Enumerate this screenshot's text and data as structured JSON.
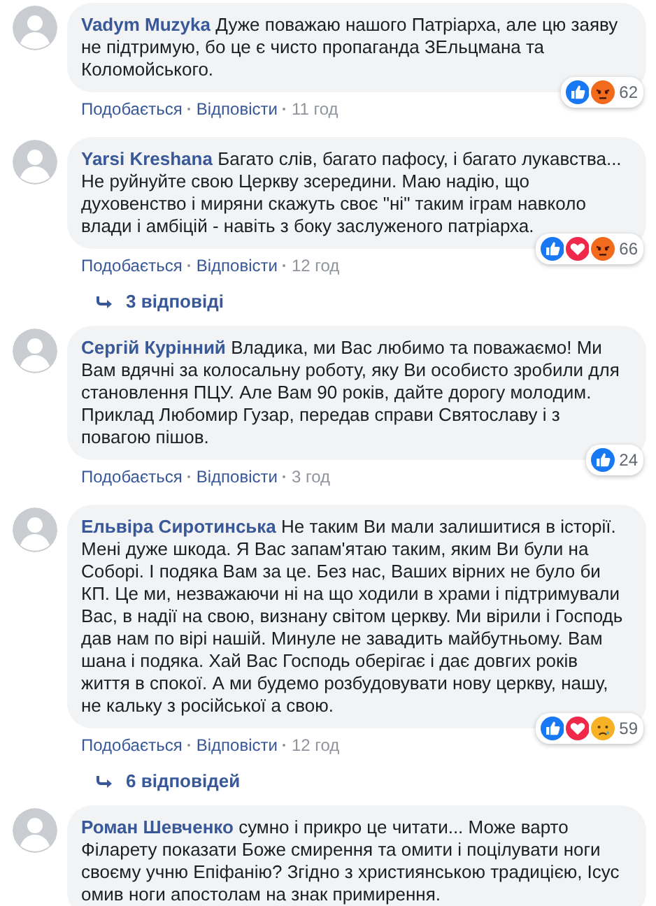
{
  "comments": [
    {
      "author": "Vadym Muzyka",
      "text": "Дуже поважаю нашого Патріарха, але цю заяву не підтримую, бо це є чисто пропаганда ЗЕльцмана та Коломойського.",
      "reactions": [
        {
          "kind": "like"
        },
        {
          "kind": "angry"
        }
      ],
      "reaction_count": "62",
      "actions": [
        "Подобається",
        "Відповісти"
      ],
      "time": "11 год"
    },
    {
      "author": "Yarsi Kreshana",
      "text": "Багато слів, багато пафосу, і багато лукавства... Не руйнуйте свою Церкву зсередини. Маю надію, що духовенство і миряни скажуть своє \"ні\" таким іграм навколо влади і амбіцій - навіть з боку заслуженого патріарха.",
      "reactions": [
        {
          "kind": "like"
        },
        {
          "kind": "love"
        },
        {
          "kind": "angry"
        }
      ],
      "reaction_count": "66",
      "actions": [
        "Подобається",
        "Відповісти"
      ],
      "time": "12 год",
      "replies": "3 відповіді"
    },
    {
      "author": "Сергій Курінний",
      "text": "Владика, ми Вас любимо та поважаємо! Ми Вам вдячні за колосальну роботу, яку Ви особисто зробили для становлення ПЦУ. Але Вам 90 років, дайте дорогу молодим. Приклад Любомир Гузар, передав справи Святославу і з повагою пішов.",
      "reactions": [
        {
          "kind": "like"
        }
      ],
      "reaction_count": "24",
      "actions": [
        "Подобається",
        "Відповісти"
      ],
      "time": "3 год"
    },
    {
      "author": "Ельвіра Сиротинська",
      "text": "Не таким Ви мали залишитися в історії. Мені дуже шкода. Я Вас запам'ятаю таким, яким Ви були на Соборі. І подяка Вам за це. Без нас, Ваших вірних не було би КП. Це ми, незважаючи ні на що ходили в храми і підтримували Вас, в надії на свою, визнану світом церкву. Ми вірили і Господь дав нам по вірі нашій. Минуле не завадить майбутньому. Вам шана і подяка. Хай Вас Господь оберігає і дає довгих років життя в спокої. А ми будемо розбудовувати нову церкву, нашу, не кальку з російської а свою.",
      "reactions": [
        {
          "kind": "like"
        },
        {
          "kind": "love"
        },
        {
          "kind": "sad"
        }
      ],
      "reaction_count": "59",
      "actions": [
        "Подобається",
        "Відповісти"
      ],
      "time": "12 год",
      "replies": "6 відповідей"
    },
    {
      "author": "Роман Шевченко",
      "text": "сумно і прикро це читати... Може варто Філарету показати Боже смирення та омити і поцілувати ноги своєму учню Епіфанію? Згідно з християнською традицією, Ісус омив ноги апостолам на знак примирення."
    }
  ]
}
